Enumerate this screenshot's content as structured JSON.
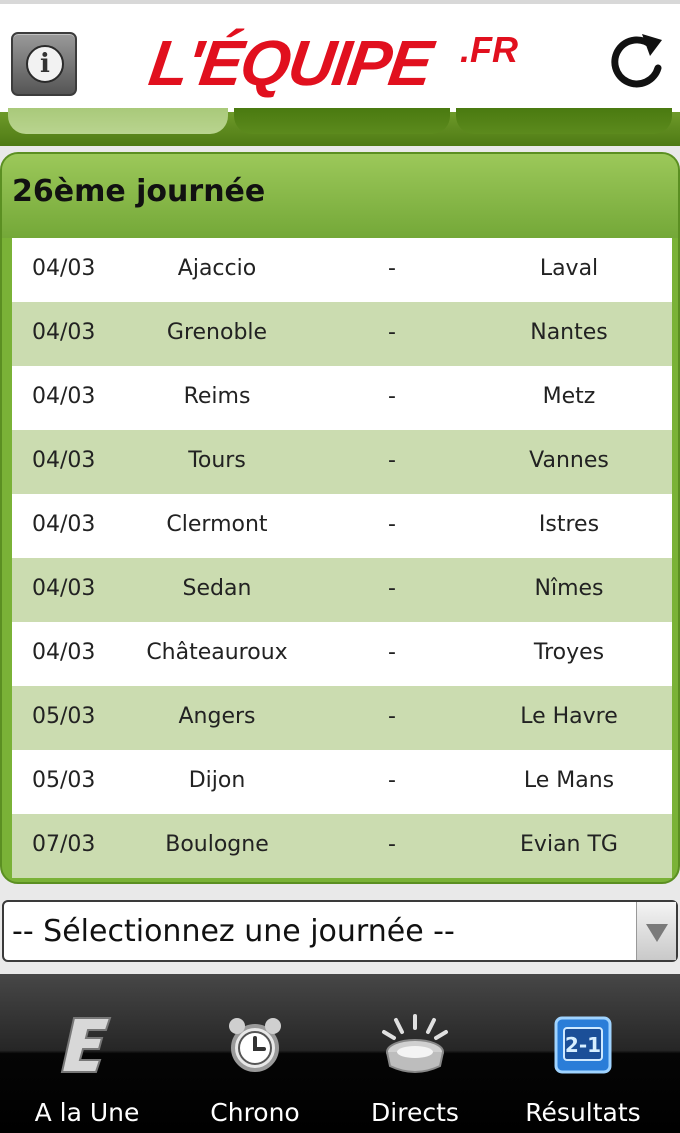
{
  "header": {
    "logo_main": "L'ÉQUIPE",
    "logo_suffix": ".FR"
  },
  "round": {
    "title": "26ème journée",
    "matches": [
      {
        "date": "04/03",
        "home": "Ajaccio",
        "score": "-",
        "away": "Laval"
      },
      {
        "date": "04/03",
        "home": "Grenoble",
        "score": "-",
        "away": "Nantes"
      },
      {
        "date": "04/03",
        "home": "Reims",
        "score": "-",
        "away": "Metz"
      },
      {
        "date": "04/03",
        "home": "Tours",
        "score": "-",
        "away": "Vannes"
      },
      {
        "date": "04/03",
        "home": "Clermont",
        "score": "-",
        "away": "Istres"
      },
      {
        "date": "04/03",
        "home": "Sedan",
        "score": "-",
        "away": "Nîmes"
      },
      {
        "date": "04/03",
        "home": "Châteauroux",
        "score": "-",
        "away": "Troyes"
      },
      {
        "date": "05/03",
        "home": "Angers",
        "score": "-",
        "away": "Le Havre"
      },
      {
        "date": "05/03",
        "home": "Dijon",
        "score": "-",
        "away": "Le Mans"
      },
      {
        "date": "07/03",
        "home": "Boulogne",
        "score": "-",
        "away": "Evian TG"
      }
    ]
  },
  "selector": {
    "value": "-- Sélectionnez une journée --"
  },
  "nav": {
    "items": [
      {
        "label": "A la Une",
        "icon": "e-logo-icon"
      },
      {
        "label": "Chrono",
        "icon": "alarm-clock-icon"
      },
      {
        "label": "Directs",
        "icon": "stadium-icon"
      },
      {
        "label": "Résultats",
        "icon": "scoreboard-icon"
      }
    ]
  },
  "colors": {
    "brand_red": "#e1101e",
    "green": "#7ab237",
    "row_alt": "#cbdcb0"
  }
}
